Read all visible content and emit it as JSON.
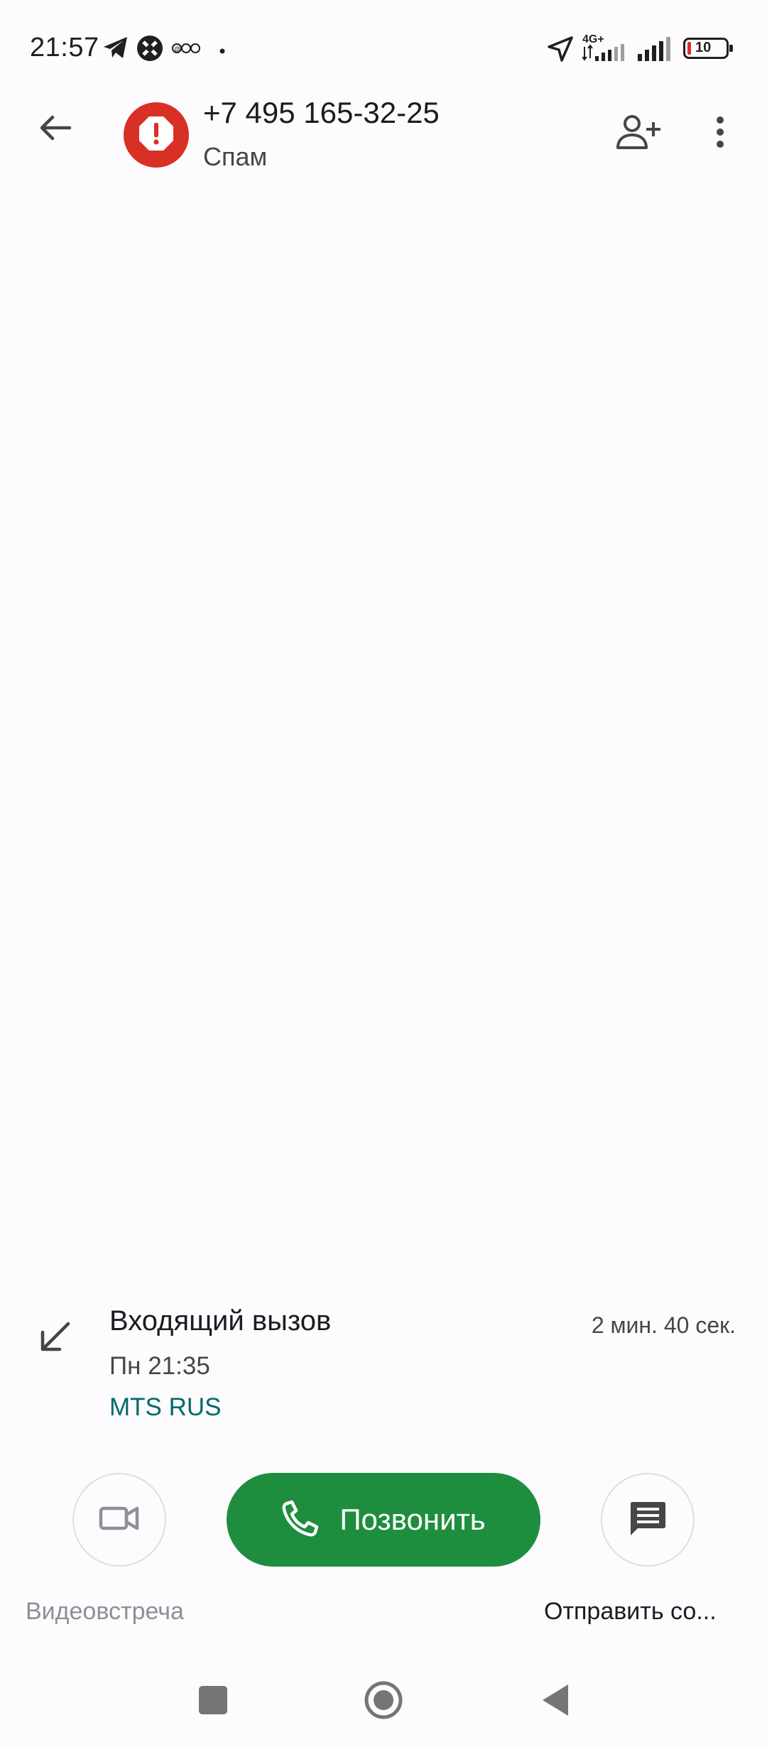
{
  "status_bar": {
    "time": "21:57",
    "network_label": "4G+",
    "battery": "10",
    "icons": [
      "telegram-icon",
      "app-icon",
      "notification-icon",
      "dot-icon",
      "location-icon",
      "signal-icon",
      "signal-icon",
      "battery-icon"
    ]
  },
  "header": {
    "back_icon": "arrow-back-icon",
    "avatar_icon": "spam-alert-icon",
    "number": "+7 495 165-32-25",
    "label": "Спам",
    "add_contact_icon": "person-add-icon",
    "menu_icon": "more-vert-icon"
  },
  "call": {
    "direction_icon": "arrow-incoming-icon",
    "type": "Входящий вызов",
    "time": "Пн 21:35",
    "sim": "MTS RUS",
    "duration": "2 мин. 40 сек."
  },
  "actions": {
    "video_label": "Видеовстреча",
    "call_label": "Позвонить",
    "message_label": "Отправить со..."
  },
  "colors": {
    "background": "#fdfbfe",
    "spam_red": "#d93025",
    "call_green": "#1e8e3e",
    "sim_teal": "#00696b"
  },
  "nav_bar": {
    "recents_icon": "square-icon",
    "home_icon": "circle-icon",
    "back_icon": "triangle-back-icon"
  }
}
